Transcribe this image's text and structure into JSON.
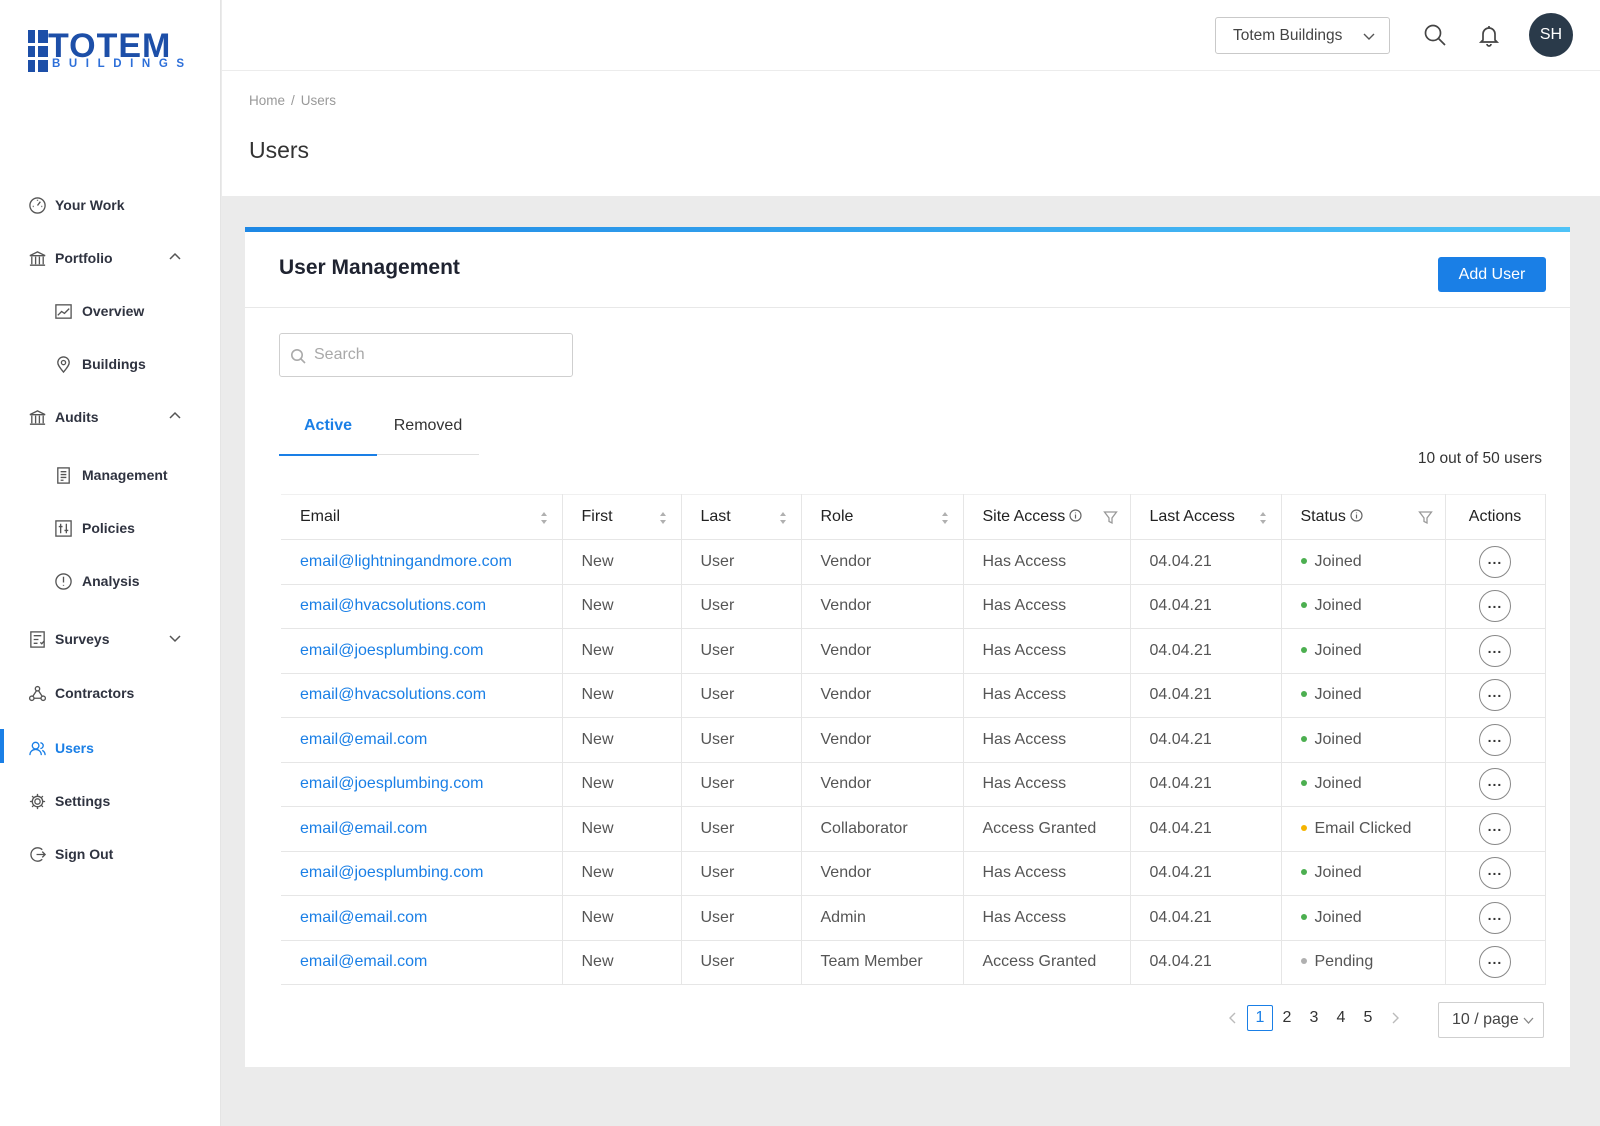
{
  "brand": {
    "logo_word": "TOTEM",
    "logo_sub": "BUILDINGS",
    "color": "#1d4fa8"
  },
  "sidebar": {
    "items": [
      {
        "label": "Your Work",
        "icon": "gauge-icon"
      },
      {
        "label": "Portfolio",
        "icon": "bank-icon",
        "expanded": true
      },
      {
        "label": "Overview",
        "icon": "chart-line-icon"
      },
      {
        "label": "Buildings",
        "icon": "map-pin-icon"
      },
      {
        "label": "Audits",
        "icon": "bank-icon",
        "expanded": true
      },
      {
        "label": "Management",
        "icon": "document-icon"
      },
      {
        "label": "Policies",
        "icon": "sliders-icon"
      },
      {
        "label": "Analysis",
        "icon": "alert-circle-icon"
      },
      {
        "label": "Surveys",
        "icon": "checklist-icon",
        "expanded": false
      },
      {
        "label": "Contractors",
        "icon": "network-icon"
      },
      {
        "label": "Users",
        "icon": "users-icon",
        "active": true
      },
      {
        "label": "Settings",
        "icon": "gear-icon"
      },
      {
        "label": "Sign Out",
        "icon": "sign-out-icon"
      }
    ]
  },
  "header": {
    "org_select": "Totem Buildings",
    "avatar_initials": "SH"
  },
  "breadcrumb": {
    "home": "Home",
    "sep": "/",
    "current": "Users"
  },
  "page_title": "Users",
  "card": {
    "title": "User Management",
    "add_button": "Add User",
    "search_placeholder": "Search",
    "tabs": [
      {
        "label": "Active",
        "active": true
      },
      {
        "label": "Removed",
        "active": false
      }
    ],
    "count_text": "10 out of 50 users"
  },
  "table": {
    "columns": [
      "Email",
      "First",
      "Last",
      "Role",
      "Site Access",
      "Last Access",
      "Status",
      "Actions"
    ],
    "rows": [
      {
        "email": "email@lightningandmore.com",
        "first": "New",
        "last": "User",
        "role": "Vendor",
        "site_access": "Has Access",
        "last_access": "04.04.21",
        "status": "Joined",
        "status_color": "#4caf50"
      },
      {
        "email": "email@hvacsolutions.com",
        "first": "New",
        "last": "User",
        "role": "Vendor",
        "site_access": "Has Access",
        "last_access": "04.04.21",
        "status": "Joined",
        "status_color": "#4caf50"
      },
      {
        "email": "email@joesplumbing.com",
        "first": "New",
        "last": "User",
        "role": "Vendor",
        "site_access": "Has Access",
        "last_access": "04.04.21",
        "status": "Joined",
        "status_color": "#4caf50"
      },
      {
        "email": "email@hvacsolutions.com",
        "first": "New",
        "last": "User",
        "role": "Vendor",
        "site_access": "Has Access",
        "last_access": "04.04.21",
        "status": "Joined",
        "status_color": "#4caf50"
      },
      {
        "email": "email@email.com",
        "first": "New",
        "last": "User",
        "role": "Vendor",
        "site_access": "Has Access",
        "last_access": "04.04.21",
        "status": "Joined",
        "status_color": "#4caf50"
      },
      {
        "email": "email@joesplumbing.com",
        "first": "New",
        "last": "User",
        "role": "Vendor",
        "site_access": "Has Access",
        "last_access": "04.04.21",
        "status": "Joined",
        "status_color": "#4caf50"
      },
      {
        "email": "email@email.com",
        "first": "New",
        "last": "User",
        "role": "Collaborator",
        "site_access": "Access Granted",
        "last_access": "04.04.21",
        "status": "Email Clicked",
        "status_color": "#f5b400"
      },
      {
        "email": "email@joesplumbing.com",
        "first": "New",
        "last": "User",
        "role": "Vendor",
        "site_access": "Has Access",
        "last_access": "04.04.21",
        "status": "Joined",
        "status_color": "#4caf50"
      },
      {
        "email": "email@email.com",
        "first": "New",
        "last": "User",
        "role": "Admin",
        "site_access": "Has Access",
        "last_access": "04.04.21",
        "status": "Joined",
        "status_color": "#4caf50"
      },
      {
        "email": "email@email.com",
        "first": "New",
        "last": "User",
        "role": "Team Member",
        "site_access": "Access Granted",
        "last_access": "04.04.21",
        "status": "Pending",
        "status_color": "#b0b0b0"
      }
    ]
  },
  "pagination": {
    "pages": [
      "1",
      "2",
      "3",
      "4",
      "5"
    ],
    "current": "1",
    "per_page": "10 / page"
  },
  "colors": {
    "accent": "#1a7fe6",
    "joined": "#4caf50",
    "clicked": "#f5b400",
    "pending": "#b0b0b0"
  }
}
